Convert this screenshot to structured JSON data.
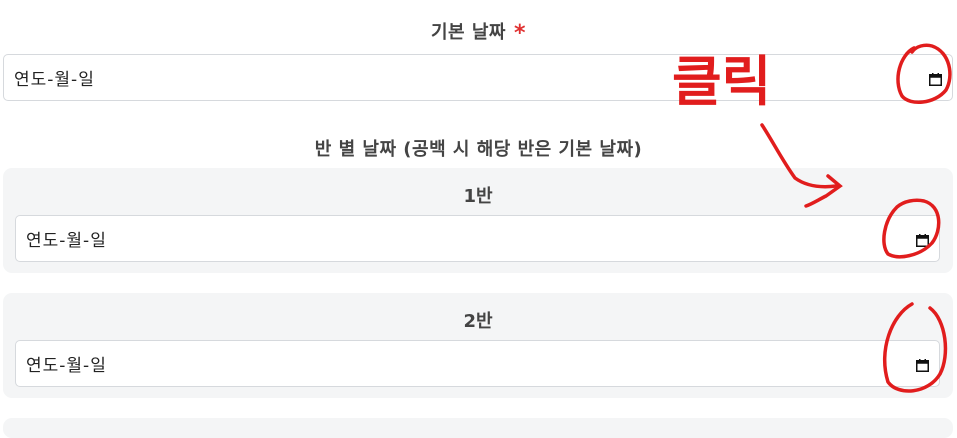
{
  "default_date": {
    "label": "기본 날짜",
    "required_mark": "*",
    "placeholder": "연도-월-일"
  },
  "class_dates": {
    "heading": "반 별 날짜 (공백 시 해당 반은 기본 날짜)",
    "classes": [
      {
        "title": "1반",
        "placeholder": "연도-월-일"
      },
      {
        "title": "2반",
        "placeholder": "연도-월-일"
      }
    ]
  },
  "annotation": {
    "text": "클릭",
    "color": "#e11d1d"
  },
  "icons": {
    "calendar": "calendar-icon"
  }
}
